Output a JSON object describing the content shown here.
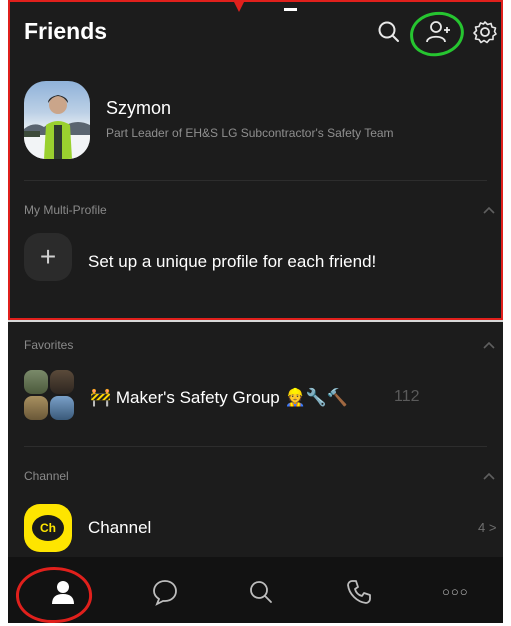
{
  "header": {
    "title": "Friends",
    "icons": [
      "search-icon",
      "add-friend-icon",
      "settings-icon"
    ]
  },
  "profile": {
    "name": "Szymon",
    "description": "Part Leader of EH&S LG Subcontractor's Safety Team"
  },
  "multi_profile": {
    "section_label": "My Multi-Profile",
    "add_symbol": "+",
    "add_label": "Set up a unique profile for each friend!"
  },
  "favorites": {
    "section_label": "Favorites",
    "group_name": "🚧 Maker's Safety Group 👷🔧🔨",
    "group_count": "112"
  },
  "channel": {
    "section_label": "Channel",
    "logo_text": "Ch",
    "name": "Channel",
    "count": "4 >"
  },
  "bottom_nav": {
    "items": [
      "friends-icon",
      "chats-icon",
      "search-icon",
      "calls-icon",
      "more-icon"
    ],
    "more_label": "○○○"
  },
  "annotations": {
    "highlight_red": "#e0201c",
    "highlight_green": "#26c530"
  },
  "colors": {
    "background": "#1c1c1c",
    "nav_background": "#121212",
    "channel_yellow": "#fee500",
    "muted_text": "#8f8f8f"
  }
}
